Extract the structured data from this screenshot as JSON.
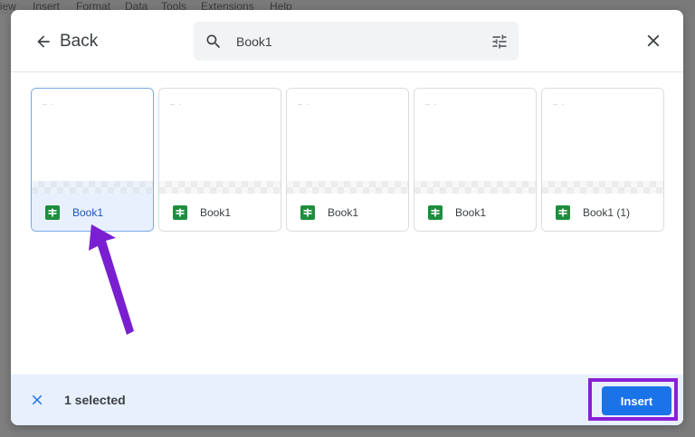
{
  "background_app": {
    "menu_items": [
      "View",
      "Insert",
      "Format",
      "Data",
      "Tools",
      "Extensions",
      "Help"
    ]
  },
  "dialog": {
    "back_label": "Back",
    "search": {
      "value": "Book1",
      "icon": "search-icon",
      "filter_icon": "tune-icon"
    },
    "close_icon": "close-icon",
    "files": [
      {
        "name": "Book1",
        "selected": true,
        "icon": "google-sheets-icon"
      },
      {
        "name": "Book1",
        "selected": false,
        "icon": "google-sheets-icon"
      },
      {
        "name": "Book1",
        "selected": false,
        "icon": "google-sheets-icon"
      },
      {
        "name": "Book1",
        "selected": false,
        "icon": "google-sheets-icon"
      },
      {
        "name": "Book1 (1)",
        "selected": false,
        "icon": "google-sheets-icon"
      }
    ],
    "footer": {
      "selected_count": "1 selected",
      "insert_label": "Insert"
    }
  },
  "colors": {
    "accent": "#1a73e8",
    "selection_bg": "#e8f0fe",
    "annotation": "#8a1fd6",
    "sheets_green": "#1e8e3e"
  }
}
